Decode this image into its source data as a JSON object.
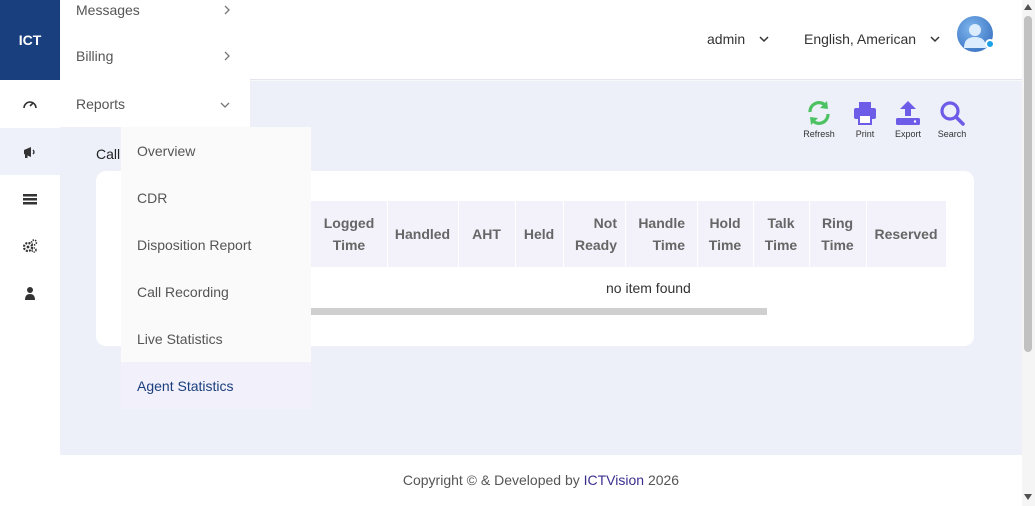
{
  "brand": {
    "logo_text": "ICT"
  },
  "header": {
    "user": "admin",
    "language": "English, American"
  },
  "rail": {
    "icons": [
      "dashboard-icon",
      "megaphone-icon",
      "list-icon",
      "settings-icon",
      "user-icon"
    ]
  },
  "menu": {
    "items": [
      {
        "label": "Messages",
        "state": "collapsed"
      },
      {
        "label": "Billing",
        "state": "collapsed"
      },
      {
        "label": "Reports",
        "state": "expanded"
      }
    ],
    "reports_submenu": [
      {
        "label": "Overview"
      },
      {
        "label": "CDR"
      },
      {
        "label": "Disposition Report"
      },
      {
        "label": "Call Recording"
      },
      {
        "label": "Live Statistics"
      },
      {
        "label": "Agent Statistics",
        "active": true
      }
    ]
  },
  "page": {
    "section_label": "Call",
    "toolbar": {
      "refresh": "Refresh",
      "print": "Print",
      "export": "Export",
      "search": "Search"
    },
    "table": {
      "columns": [
        [
          "Logged",
          "Time"
        ],
        [
          "Handled"
        ],
        [
          "AHT"
        ],
        [
          "Held"
        ],
        [
          "Not",
          "Ready"
        ],
        [
          "Handle",
          "Time"
        ],
        [
          "Hold",
          "Time"
        ],
        [
          "Talk",
          "Time"
        ],
        [
          "Ring",
          "Time"
        ],
        [
          "Reserved"
        ]
      ],
      "empty_message": "no item found"
    }
  },
  "footer": {
    "prefix": "Copyright © & Developed by ",
    "brand": "ICTVision",
    "year": " 2026"
  },
  "colors": {
    "accent": "#1a3f7e",
    "tool_purple": "#6c5ce7",
    "refresh_green": "#4cc262",
    "content_bg": "#eef0f9"
  }
}
